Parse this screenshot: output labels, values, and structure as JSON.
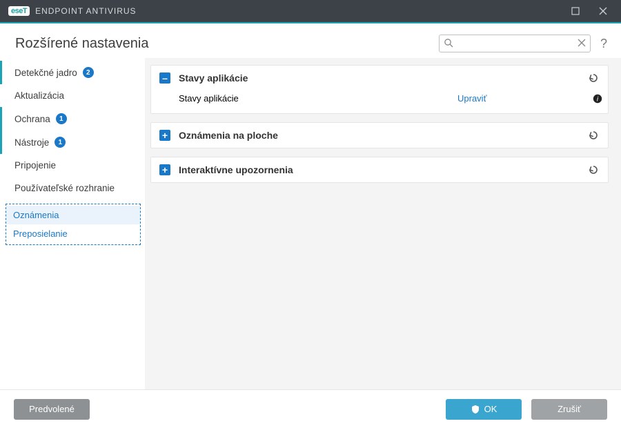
{
  "window": {
    "brand_badge": "eseT",
    "app_name": "ENDPOINT ANTIVIRUS"
  },
  "header": {
    "title": "Rozšírené nastavenia",
    "search_placeholder": "",
    "search_value": ""
  },
  "sidebar": {
    "items": [
      {
        "label": "Detekčné jadro",
        "badge": "2"
      },
      {
        "label": "Aktualizácia",
        "badge": null
      },
      {
        "label": "Ochrana",
        "badge": "1"
      },
      {
        "label": "Nástroje",
        "badge": "1"
      },
      {
        "label": "Pripojenie",
        "badge": null
      },
      {
        "label": "Používateľské rozhranie",
        "badge": null
      }
    ],
    "active_sub_group": {
      "items": [
        {
          "label": "Oznámenia",
          "active": true
        },
        {
          "label": "Preposielanie",
          "active": false
        }
      ]
    }
  },
  "panels": [
    {
      "expanded": true,
      "title": "Stavy aplikácie",
      "rows": [
        {
          "label": "Stavy aplikácie",
          "action": "Upraviť"
        }
      ]
    },
    {
      "expanded": false,
      "title": "Oznámenia na ploche"
    },
    {
      "expanded": false,
      "title": "Interaktívne upozornenia"
    }
  ],
  "footer": {
    "default": "Predvolené",
    "ok": "OK",
    "cancel": "Zrušiť"
  },
  "icons": {
    "minus": "–",
    "plus": "+"
  }
}
